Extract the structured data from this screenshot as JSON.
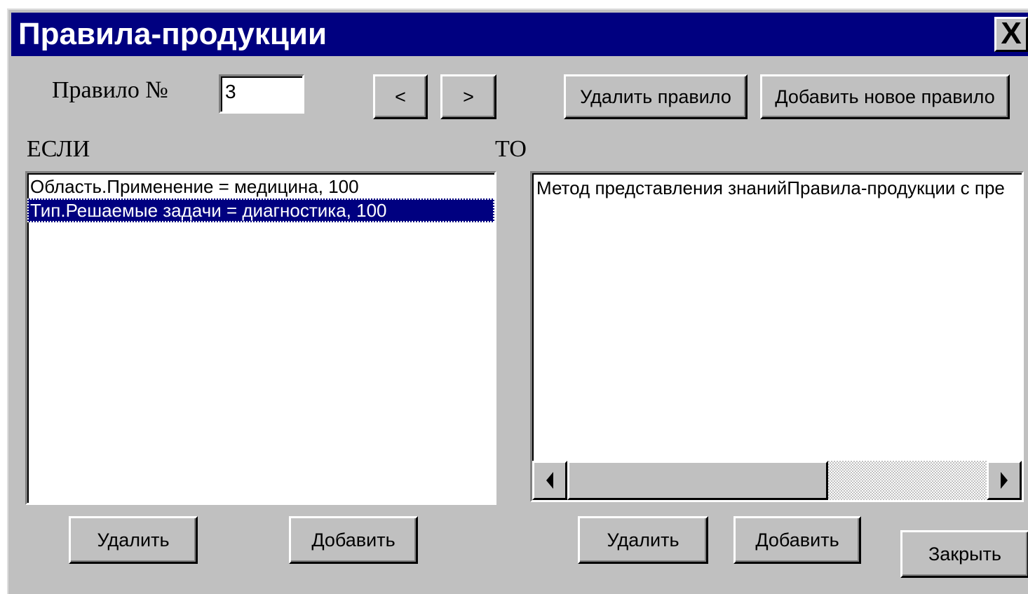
{
  "window": {
    "title": "Правила-продукции",
    "close_label": "X"
  },
  "rule": {
    "label": "Правило №",
    "number": "3",
    "prev_label": "<",
    "next_label": ">",
    "delete_rule_label": "Удалить правило",
    "add_rule_label": "Добавить новое правило"
  },
  "if_section": {
    "label": "ЕСЛИ",
    "items": [
      "Область.Применение = медицина, 100",
      "Тип.Решаемые задачи = диагностика, 100"
    ],
    "selected_index": 1,
    "delete_label": "Удалить",
    "add_label": "Добавить"
  },
  "then_section": {
    "label": "ТО",
    "text": "Метод представления знанийПравила-продукции с пре",
    "delete_label": "Удалить",
    "add_label": "Добавить"
  },
  "close_button_label": "Закрыть",
  "icons": {
    "scroll_left": "scroll-left-arrow-icon",
    "scroll_right": "scroll-right-arrow-icon"
  },
  "colors": {
    "titlebar": "#000080",
    "face": "#c0c0c0",
    "selection": "#000080"
  }
}
